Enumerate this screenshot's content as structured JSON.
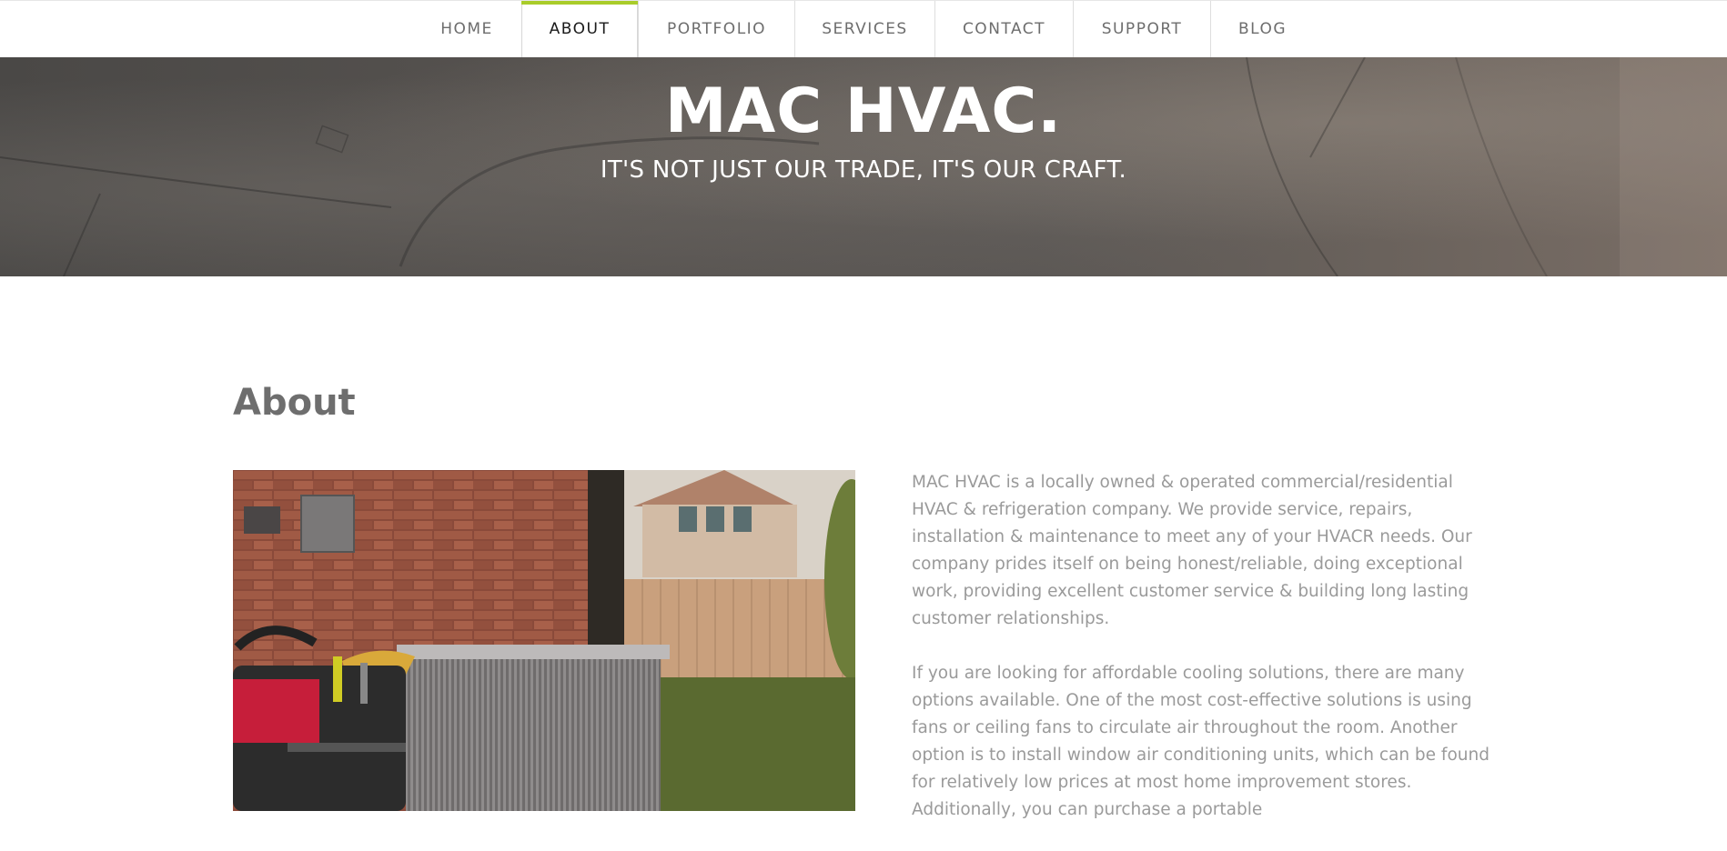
{
  "nav": {
    "items": [
      {
        "label": "HOME"
      },
      {
        "label": "ABOUT",
        "active": true
      },
      {
        "label": "PORTFOLIO"
      },
      {
        "label": "SERVICES"
      },
      {
        "label": "CONTACT"
      },
      {
        "label": "SUPPORT"
      },
      {
        "label": "BLOG"
      }
    ]
  },
  "hero": {
    "title": "MAC HVAC.",
    "subtitle": "IT'S NOT JUST OUR TRADE, IT'S OUR CRAFT."
  },
  "about": {
    "heading": "About",
    "paragraphs": [
      "MAC HVAC is a locally owned & operated commercial/residential HVAC & refrigeration company. We provide service, repairs, installation & maintenance to meet any of your HVACR needs. Our company prides itself on being honest/reliable, doing exceptional work, providing excellent customer service & building long lasting customer relationships.",
      "If you are looking for affordable cooling solutions, there are many options available. One of the most cost-effective solutions is using fans or ceiling fans to circulate air throughout the room. Another option is to install window air conditioning units, which can be found for relatively low prices at most home improvement stores. Additionally, you can purchase a portable"
    ]
  },
  "colors": {
    "accent": "#a9cc2a",
    "nav_text": "#6d6d6d",
    "heading": "#6e6e6e",
    "body_text": "#9a9a9a"
  }
}
